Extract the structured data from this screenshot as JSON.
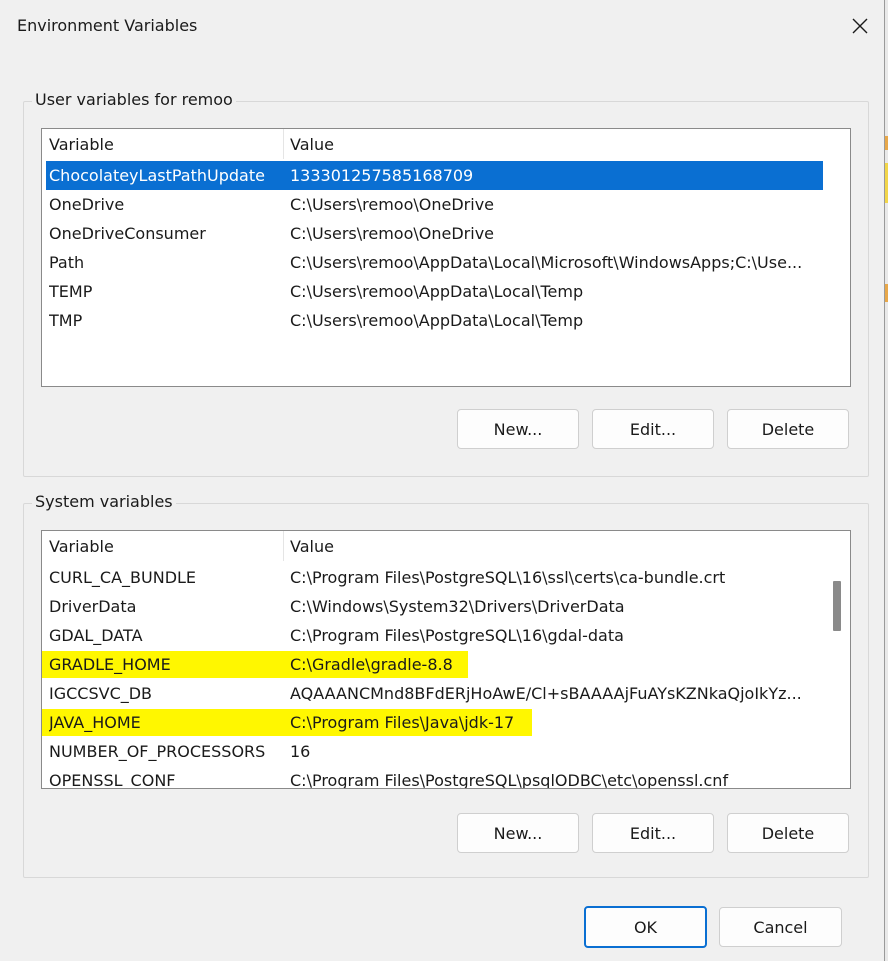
{
  "window": {
    "title": "Environment Variables",
    "close_icon": "close-icon"
  },
  "user_variables": {
    "group_label": "User variables for remoo",
    "columns": [
      "Variable",
      "Value"
    ],
    "rows": [
      {
        "variable": "ChocolateyLastPathUpdate",
        "value": "133301257585168709",
        "selected": true
      },
      {
        "variable": "OneDrive",
        "value": "C:\\Users\\remoo\\OneDrive"
      },
      {
        "variable": "OneDriveConsumer",
        "value": "C:\\Users\\remoo\\OneDrive"
      },
      {
        "variable": "Path",
        "value": "C:\\Users\\remoo\\AppData\\Local\\Microsoft\\WindowsApps;C:\\Use..."
      },
      {
        "variable": "TEMP",
        "value": "C:\\Users\\remoo\\AppData\\Local\\Temp"
      },
      {
        "variable": "TMP",
        "value": "C:\\Users\\remoo\\AppData\\Local\\Temp"
      }
    ],
    "buttons": {
      "new": "New...",
      "edit": "Edit...",
      "delete": "Delete"
    }
  },
  "system_variables": {
    "group_label": "System variables",
    "columns": [
      "Variable",
      "Value"
    ],
    "rows": [
      {
        "variable": "CURL_CA_BUNDLE",
        "value": "C:\\Program Files\\PostgreSQL\\16\\ssl\\certs\\ca-bundle.crt"
      },
      {
        "variable": "DriverData",
        "value": "C:\\Windows\\System32\\Drivers\\DriverData"
      },
      {
        "variable": "GDAL_DATA",
        "value": "C:\\Program Files\\PostgreSQL\\16\\gdal-data"
      },
      {
        "variable": "GRADLE_HOME",
        "value": "C:\\Gradle\\gradle-8.8",
        "highlighted": true
      },
      {
        "variable": "IGCCSVC_DB",
        "value": "AQAAANCMnd8BFdERjHoAwE/Cl+sBAAAAjFuAYsKZNkaQjoIkYz..."
      },
      {
        "variable": "JAVA_HOME",
        "value": "C:\\Program Files\\Java\\jdk-17",
        "highlighted": true
      },
      {
        "variable": "NUMBER_OF_PROCESSORS",
        "value": "16"
      },
      {
        "variable": "OPENSSL_CONF",
        "value": "C:\\Program Files\\PostgreSQL\\psqlODBC\\etc\\openssl.cnf"
      }
    ],
    "buttons": {
      "new": "New...",
      "edit": "Edit...",
      "delete": "Delete"
    }
  },
  "footer": {
    "ok": "OK",
    "cancel": "Cancel"
  },
  "colors": {
    "selection": "#0a6fd2",
    "highlight": "#fff700",
    "dialog_bg": "#f0f0f0"
  }
}
